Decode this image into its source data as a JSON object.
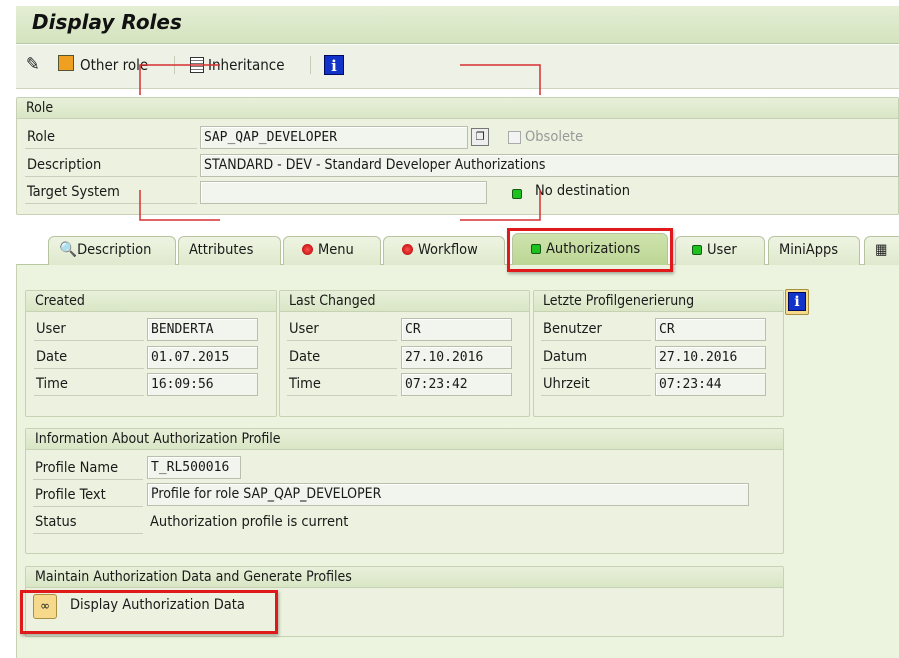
{
  "window": {
    "title": "Display Roles"
  },
  "toolbar": {
    "edit_icon": "pencil-glasses-icon",
    "other_role": "Other role",
    "inheritance": "Inheritance",
    "info_icon": "i"
  },
  "role_group": {
    "title": "Role",
    "role_label": "Role",
    "role_value": "SAP_QAP_DEVELOPER",
    "obsolete_label": "Obsolete",
    "obsolete_checked": false,
    "description_label": "Description",
    "description_value": "STANDARD - DEV - Standard Developer Authorizations",
    "target_label": "Target System",
    "target_value": "",
    "target_status": "No destination"
  },
  "tabs": [
    {
      "label": "Description",
      "icon": "magnifier-icon"
    },
    {
      "label": "Attributes"
    },
    {
      "label": "Menu",
      "status": "red"
    },
    {
      "label": "Workflow",
      "status": "red"
    },
    {
      "label": "Authorizations",
      "status": "green",
      "active": true
    },
    {
      "label": "User",
      "status": "green"
    },
    {
      "label": "MiniApps"
    }
  ],
  "created": {
    "title": "Created",
    "rows": [
      {
        "label": "User",
        "value": "BENDERTA"
      },
      {
        "label": "Date",
        "value": "01.07.2015"
      },
      {
        "label": "Time",
        "value": "16:09:56"
      }
    ]
  },
  "last_changed": {
    "title": "Last Changed",
    "rows": [
      {
        "label": "User",
        "value": "CR"
      },
      {
        "label": "Date",
        "value": "27.10.2016"
      },
      {
        "label": "Time",
        "value": "07:23:42"
      }
    ]
  },
  "profile_gen": {
    "title": "Letzte Profilgenerierung",
    "rows": [
      {
        "label": "Benutzer",
        "value": "CR"
      },
      {
        "label": "Datum",
        "value": "27.10.2016"
      },
      {
        "label": "Uhrzeit",
        "value": "07:23:44"
      }
    ]
  },
  "profile_info": {
    "title": "Information About Authorization Profile",
    "name_label": "Profile Name",
    "name_value": "T_RL500016",
    "text_label": "Profile Text",
    "text_value": "Profile for role SAP_QAP_DEVELOPER",
    "status_label": "Status",
    "status_value": "Authorization profile is current"
  },
  "maintain": {
    "title": "Maintain Authorization Data and Generate Profiles",
    "button_label": "Display Authorization Data"
  },
  "colors": {
    "highlight": "#e01a1a",
    "led_green": "#1ec21e",
    "panel_bg": "#ecf3de"
  }
}
